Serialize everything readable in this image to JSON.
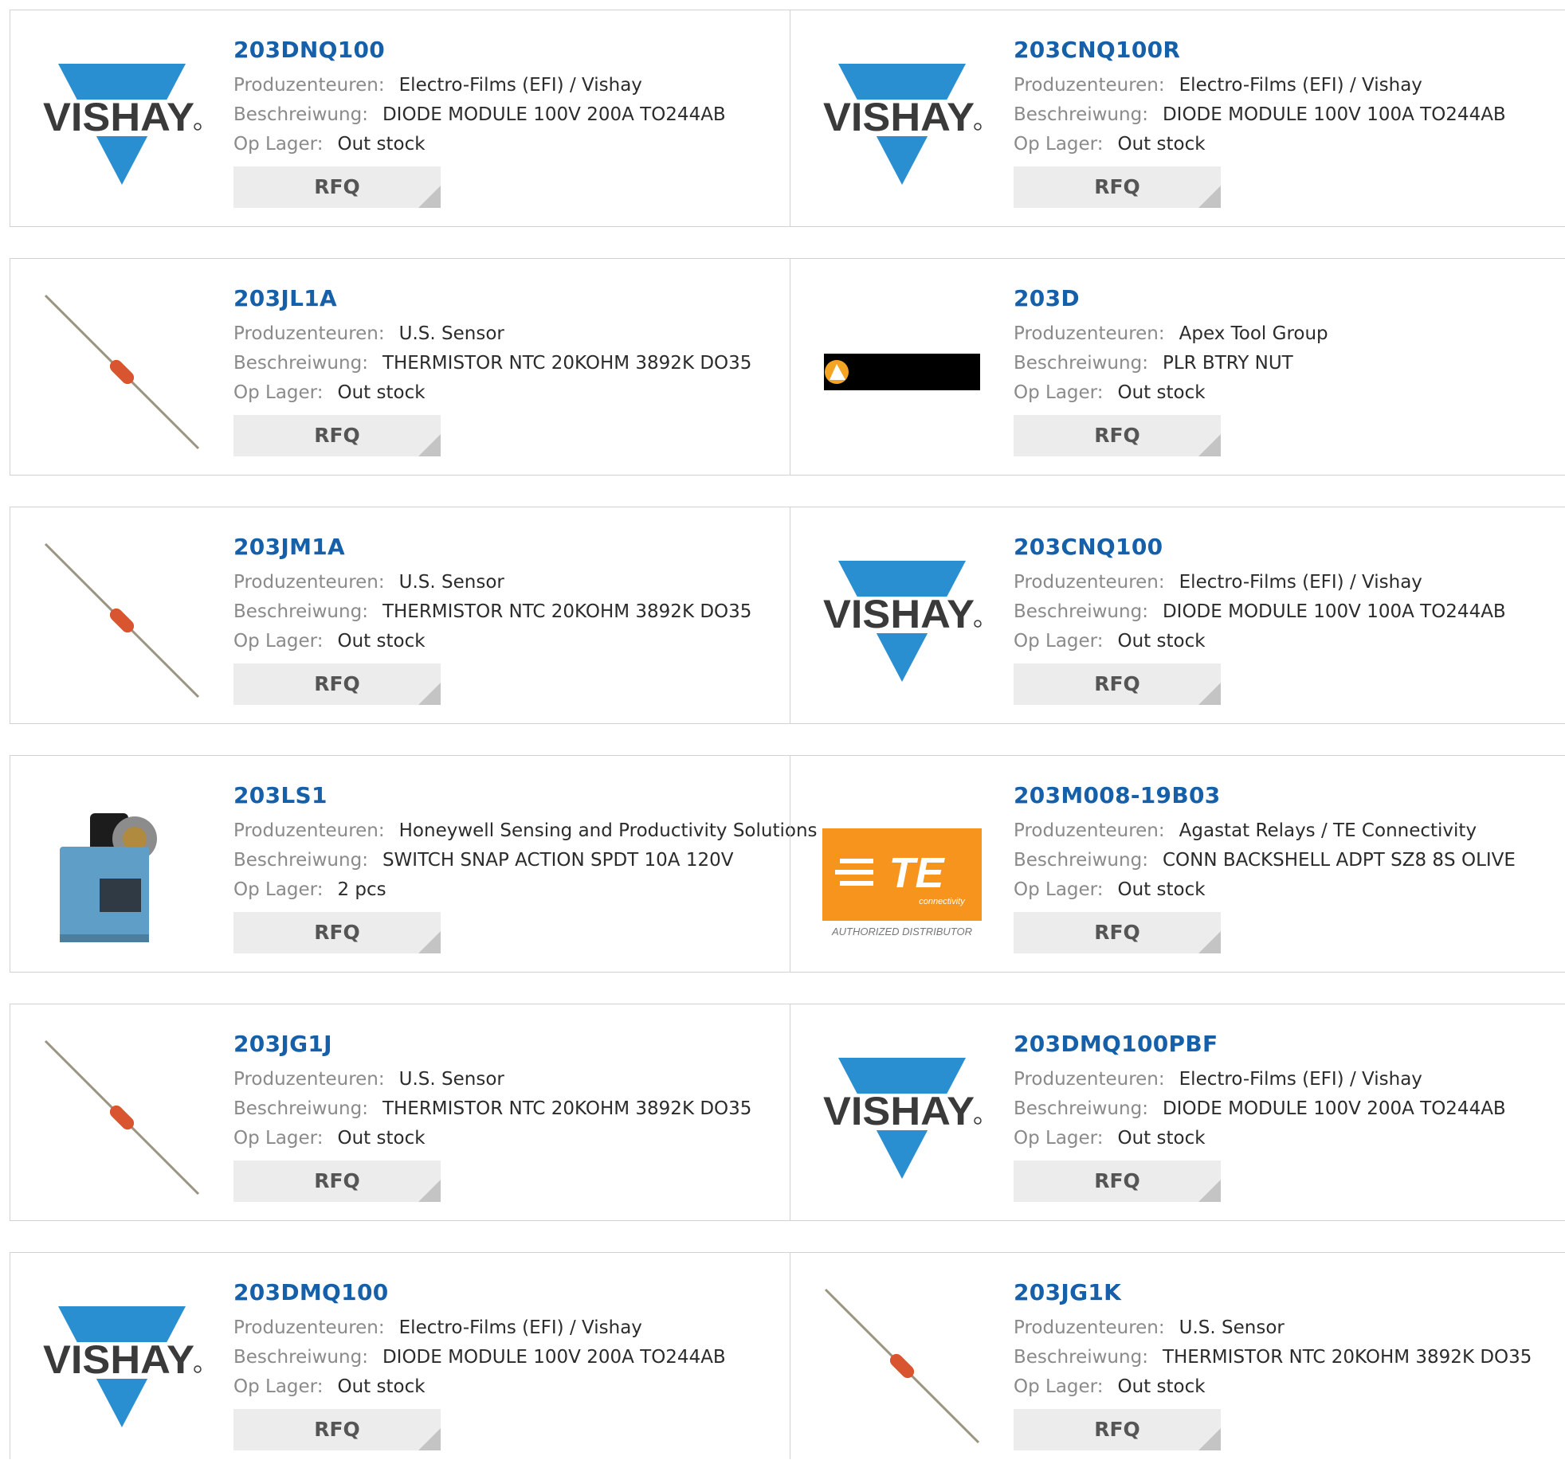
{
  "labels": {
    "manufacturer": "Produzenteuren:",
    "description": "Beschreiwung:",
    "stock": "Op Lager:",
    "rfq": "RFQ"
  },
  "logos": {
    "vishay_text": "VISHAY",
    "te_text": "TE",
    "te_sub": "connectivity",
    "te_authorized": "AUTHORIZED DISTRIBUTOR"
  },
  "colors": {
    "part_link": "#1560a8",
    "vishay_blue": "#2a8fd0",
    "te_orange": "#f7941d",
    "thermistor_body": "#d8552f"
  },
  "products": [
    {
      "part": "203DNQ100",
      "manufacturer": "Electro-Films (EFI) / Vishay",
      "description": "DIODE MODULE 100V 200A TO244AB",
      "stock": "Out stock",
      "image": "vishay-logo"
    },
    {
      "part": "203CNQ100R",
      "manufacturer": "Electro-Films (EFI) / Vishay",
      "description": "DIODE MODULE 100V 100A TO244AB",
      "stock": "Out stock",
      "image": "vishay-logo"
    },
    {
      "part": "203JL1A",
      "manufacturer": "U.S. Sensor",
      "description": "THERMISTOR NTC 20KOHM 3892K DO35",
      "stock": "Out stock",
      "image": "thermistor"
    },
    {
      "part": "203D",
      "manufacturer": "Apex Tool Group",
      "description": "PLR BTRY NUT",
      "stock": "Out stock",
      "image": "apex-logo"
    },
    {
      "part": "203JM1A",
      "manufacturer": "U.S. Sensor",
      "description": "THERMISTOR NTC 20KOHM 3892K DO35",
      "stock": "Out stock",
      "image": "thermistor"
    },
    {
      "part": "203CNQ100",
      "manufacturer": "Electro-Films (EFI) / Vishay",
      "description": "DIODE MODULE 100V 100A TO244AB",
      "stock": "Out stock",
      "image": "vishay-logo"
    },
    {
      "part": "203LS1",
      "manufacturer": "Honeywell Sensing and Productivity Solutions",
      "description": "SWITCH SNAP ACTION SPDT 10A 120V",
      "stock": "2 pcs",
      "image": "limit-switch"
    },
    {
      "part": "203M008-19B03",
      "manufacturer": "Agastat Relays / TE Connectivity",
      "description": "CONN BACKSHELL ADPT SZ8 8S OLIVE",
      "stock": "Out stock",
      "image": "te-logo"
    },
    {
      "part": "203JG1J",
      "manufacturer": "U.S. Sensor",
      "description": "THERMISTOR NTC 20KOHM 3892K DO35",
      "stock": "Out stock",
      "image": "thermistor"
    },
    {
      "part": "203DMQ100PBF",
      "manufacturer": "Electro-Films (EFI) / Vishay",
      "description": "DIODE MODULE 100V 200A TO244AB",
      "stock": "Out stock",
      "image": "vishay-logo"
    },
    {
      "part": "203DMQ100",
      "manufacturer": "Electro-Films (EFI) / Vishay",
      "description": "DIODE MODULE 100V 200A TO244AB",
      "stock": "Out stock",
      "image": "vishay-logo"
    },
    {
      "part": "203JG1K",
      "manufacturer": "U.S. Sensor",
      "description": "THERMISTOR NTC 20KOHM 3892K DO35",
      "stock": "Out stock",
      "image": "thermistor"
    }
  ]
}
